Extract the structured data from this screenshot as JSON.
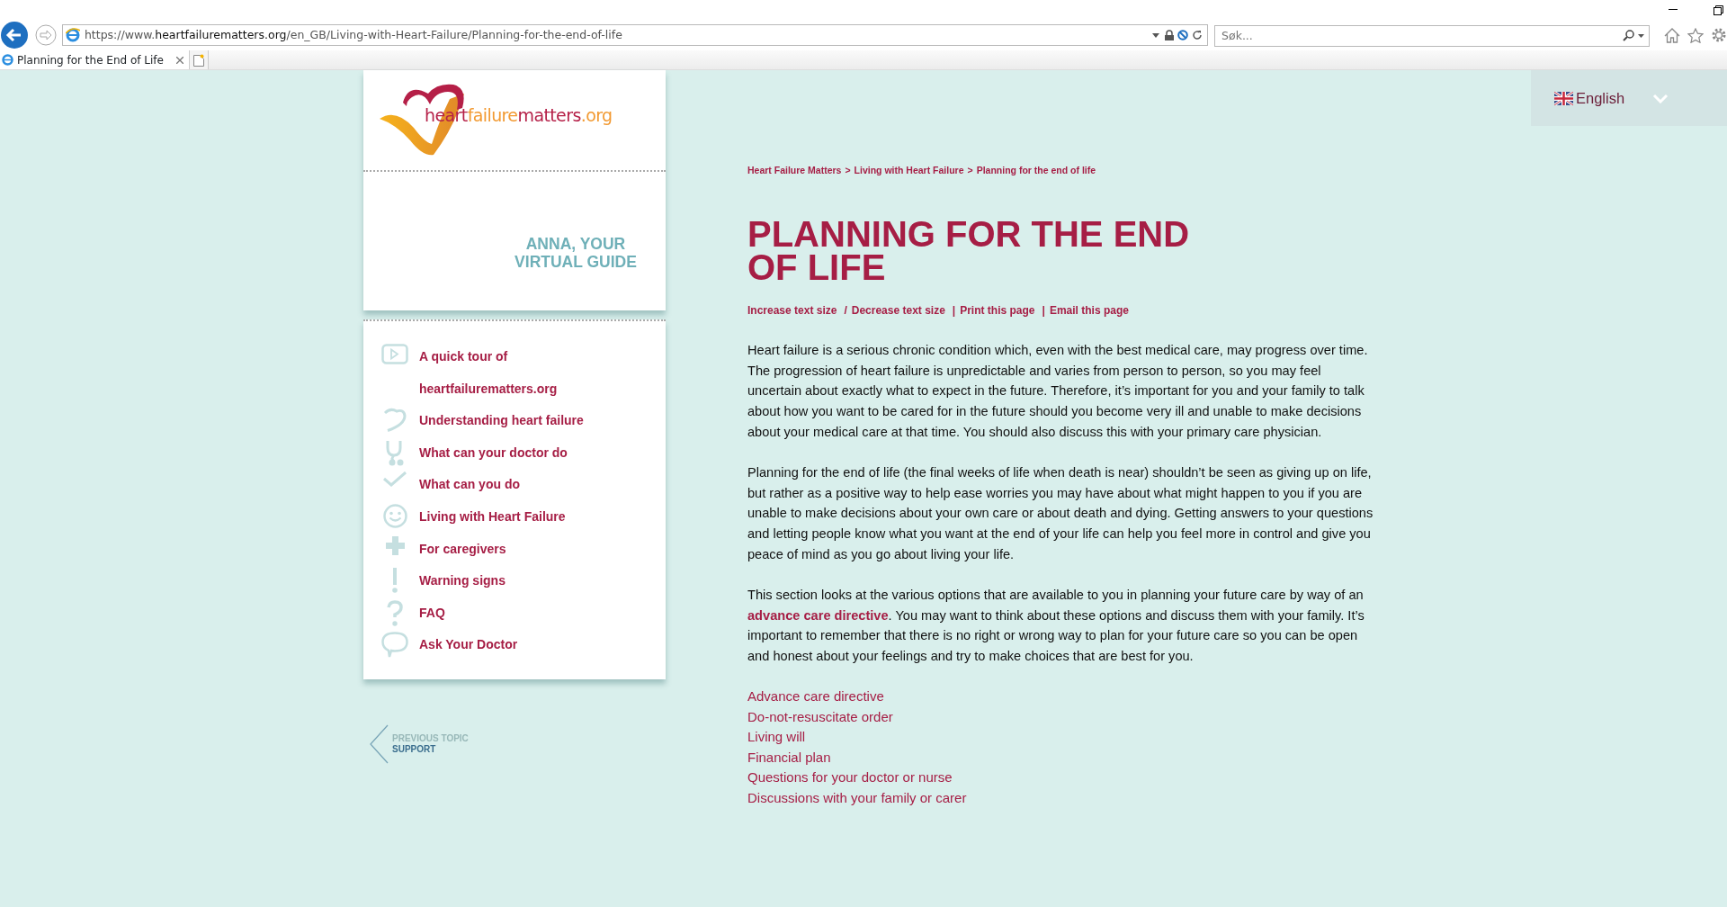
{
  "browser": {
    "url": "https://www.**heartfailurematters.org**/en_GB/Living-with-Heart-Failure/Planning-for-the-end-of-life",
    "tab_title": "Planning for the End of Life",
    "search": {
      "placeholder": "Søk..."
    }
  },
  "language": {
    "label": "English"
  },
  "logo": {
    "parts": [
      "heart",
      "failure",
      "matters",
      ".org"
    ]
  },
  "guide": {
    "label": "ANNA, YOUR VIRTUAL GUIDE"
  },
  "nav": [
    {
      "label": "A quick tour of heartfailurematters.org"
    },
    {
      "label": "Understanding heart failure"
    },
    {
      "label": "What can your doctor do"
    },
    {
      "label": "What can you do"
    },
    {
      "label": "Living with Heart Failure"
    },
    {
      "label": "For caregivers"
    },
    {
      "label": "Warning signs"
    },
    {
      "label": "FAQ"
    },
    {
      "label": "Ask Your Doctor"
    }
  ],
  "breadcrumb": {
    "separator": ">",
    "items": [
      "Heart Failure Matters",
      "Living with Heart Failure",
      "Planning for the end of life"
    ]
  },
  "title": "PLANNING FOR THE END OF LIFE",
  "tools": [
    {
      "kind": "link",
      "text": "Increase text size"
    },
    {
      "kind": "sep",
      "text": "/"
    },
    {
      "kind": "link",
      "text": "Decrease text size"
    },
    {
      "kind": "sep",
      "text": "|"
    },
    {
      "kind": "link",
      "text": "Print this page"
    },
    {
      "kind": "sep",
      "text": "|"
    },
    {
      "kind": "link",
      "text": "Email this page"
    }
  ],
  "paragraphs": [
    [
      {
        "kind": "text",
        "text": "Heart failure is a serious chronic condition which, even with the best medical care, may progress over time. The progression of heart failure is unpredictable and varies from person to person, so you may feel uncertain about exactly what to expect in the future. Therefore, it’s important for you and your family to talk about how you want to be cared for in the future should you become very ill and unable to make decisions about your medical care at that time. You should also discuss this with your primary care physician."
      }
    ],
    [
      {
        "kind": "text",
        "text": "Planning for the end of life (the final weeks of life when death is near) shouldn’t be seen as giving up on life, but rather as a positive way to help ease worries you may have about what might happen to you if you are unable to make decisions about your own care or about death and dying. Getting answers to your questions and letting people know what you want at the end of your life can help you feel more in control and give you peace of mind as you go about living your life."
      }
    ],
    [
      {
        "kind": "text",
        "text": "This section looks at the various options that are available to you in planning your future care by way of an "
      },
      {
        "kind": "link",
        "text": "advance care directive"
      },
      {
        "kind": "text",
        "text": ". You may want to think about these options and discuss them with your family. It’s important to remember that there is no right or wrong way to plan for your future care so you can be open and honest about your feelings and try to make choices that are best for you."
      }
    ]
  ],
  "topic_links": [
    "Advance care directive",
    "Do-not-resuscitate order",
    "Living will",
    "Financial plan",
    "Questions for your doctor or nurse",
    "Discussions with your family or carer"
  ],
  "previous_topic": {
    "label": "PREVIOUS TOPIC",
    "title": "SUPPORT"
  }
}
